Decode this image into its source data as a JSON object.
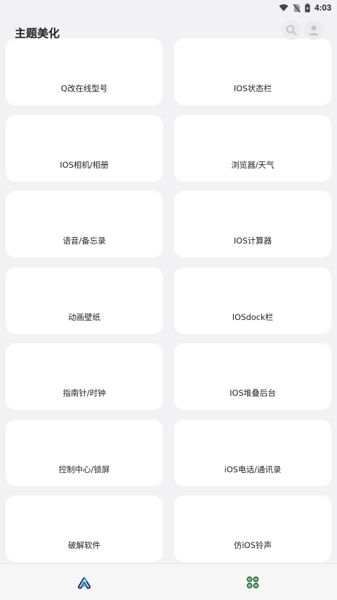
{
  "status_bar": {
    "time": "4:03",
    "icons": [
      "wifi-icon",
      "no-sim-icon",
      "battery-icon"
    ]
  },
  "header": {
    "title": "主题美化",
    "search_icon": "search-icon",
    "avatar_icon": "avatar-icon"
  },
  "cards": [
    {
      "label": "Q改在线型号"
    },
    {
      "label": "IOS状态栏"
    },
    {
      "label": "IOS相机/相册"
    },
    {
      "label": "浏览器/天气"
    },
    {
      "label": "语音/备忘录"
    },
    {
      "label": "IOS计算器"
    },
    {
      "label": "动画壁纸"
    },
    {
      "label": "IOSdock栏"
    },
    {
      "label": "指南针/时钟"
    },
    {
      "label": "IOS堆叠后台"
    },
    {
      "label": "控制中心/锁屏"
    },
    {
      "label": "iOS电话/通讯录"
    },
    {
      "label": "破解软件"
    },
    {
      "label": "仿iOS铃声"
    }
  ],
  "tabbar": {
    "tabs": [
      {
        "icon": "home-logo-icon",
        "color": "#1e88e5"
      },
      {
        "icon": "apps-grid-icon",
        "color": "#2e7d32"
      }
    ]
  }
}
